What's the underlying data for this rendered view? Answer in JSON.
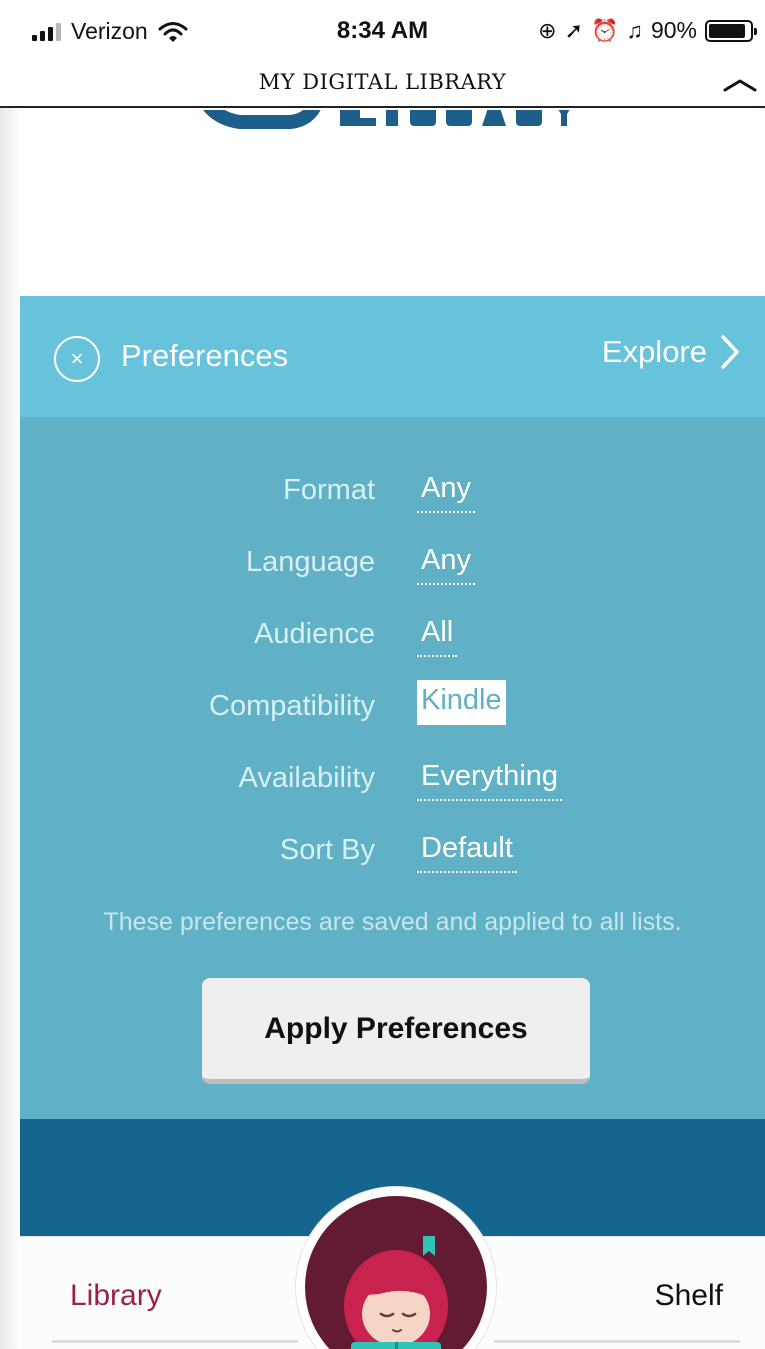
{
  "status_bar": {
    "carrier": "Verizon",
    "time": "8:34 AM",
    "battery": "90%",
    "battery_level": 0.9,
    "icons": [
      "signal-icon",
      "wifi-icon",
      "rotation-lock-icon",
      "location-icon",
      "alarm-icon",
      "headphones-icon",
      "battery-icon"
    ]
  },
  "header": {
    "title": "MY DIGITAL LIBRARY",
    "collapse_icon": "chevron-up-icon"
  },
  "preferences": {
    "title": "Preferences",
    "close_icon": "close-circle-icon",
    "explore_label": "Explore",
    "rows": [
      {
        "label": "Format",
        "value": "Any"
      },
      {
        "label": "Language",
        "value": "Any"
      },
      {
        "label": "Audience",
        "value": "All"
      },
      {
        "label": "Compatibility",
        "value": "Kindle"
      },
      {
        "label": "Availability",
        "value": "Everything"
      },
      {
        "label": "Sort By",
        "value": "Default"
      }
    ],
    "selected_row": "Compatibility",
    "note": "These preferences are saved and applied to all lists.",
    "apply_label": "Apply Preferences"
  },
  "bottom_nav": {
    "library_label": "Library",
    "shelf_label": "Shelf",
    "mascot_icon": "reading-girl-icon"
  },
  "colors": {
    "pref_bar": "#67c2db",
    "pref_panel": "#60b1c6",
    "dark_band": "#16658f",
    "library_active": "#9b2048",
    "mascot_bg": "#631b34"
  }
}
